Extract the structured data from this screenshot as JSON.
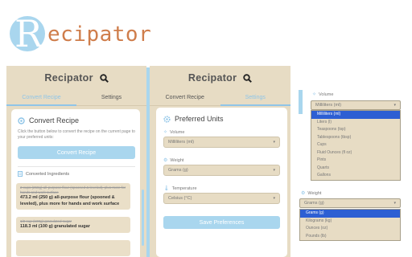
{
  "banner": {
    "logo_initial": "R",
    "logo_rest": "ecipator"
  },
  "colors": {
    "accent_blue": "#a9d6ee",
    "panel_beige": "#e7dcc4",
    "logo_orange": "#cf7d4b",
    "selected_option": "#2d5fd3"
  },
  "panel_convert": {
    "title": "Recipator",
    "tabs": [
      {
        "label": "Convert Recipe",
        "active": true
      },
      {
        "label": "Settings",
        "active": false
      }
    ],
    "card": {
      "heading": "Convert Recipe",
      "description": "Click the button below to convert the recipe on the current page to your preferred units:",
      "button": "Convert Recipe",
      "subheading": "Converted Ingredients",
      "ingredients": [
        {
          "original": "2 cups (250g) all-purpose flour (spooned & leveled), plus more for hands and work surface",
          "converted": "473.2 ml (250 g) all-purpose flour (spooned & leveled), plus more for hands and work surface"
        },
        {
          "original": "1/2 cup (100g) granulated sugar",
          "converted": "118.3 ml (100 g) granulated sugar"
        }
      ]
    }
  },
  "panel_settings": {
    "title": "Recipator",
    "tabs": [
      {
        "label": "Convert Recipe",
        "active": false
      },
      {
        "label": "Settings",
        "active": true
      }
    ],
    "card": {
      "heading": "Preferred Units",
      "fields": [
        {
          "label": "Volume",
          "value": "Milliliters (ml)"
        },
        {
          "label": "Weight",
          "value": "Grams (g)"
        },
        {
          "label": "Temperature",
          "value": "Celsius (°C)"
        }
      ],
      "button": "Save Preferences"
    }
  },
  "dropdowns": {
    "volume": {
      "label": "Volume",
      "value": "Milliliters (ml)",
      "options": [
        "Milliliters (ml)",
        "Liters (l)",
        "Teaspoons (tsp)",
        "Tablespoons (tbsp)",
        "Cups",
        "Fluid Ounces (fl oz)",
        "Pints",
        "Quarts",
        "Gallons"
      ],
      "selected_index": 0
    },
    "weight": {
      "label": "Weight",
      "value": "Grams (g)",
      "options": [
        "Grams (g)",
        "Kilograms (kg)",
        "Ounces (oz)",
        "Pounds (lb)"
      ],
      "selected_index": 0
    }
  }
}
